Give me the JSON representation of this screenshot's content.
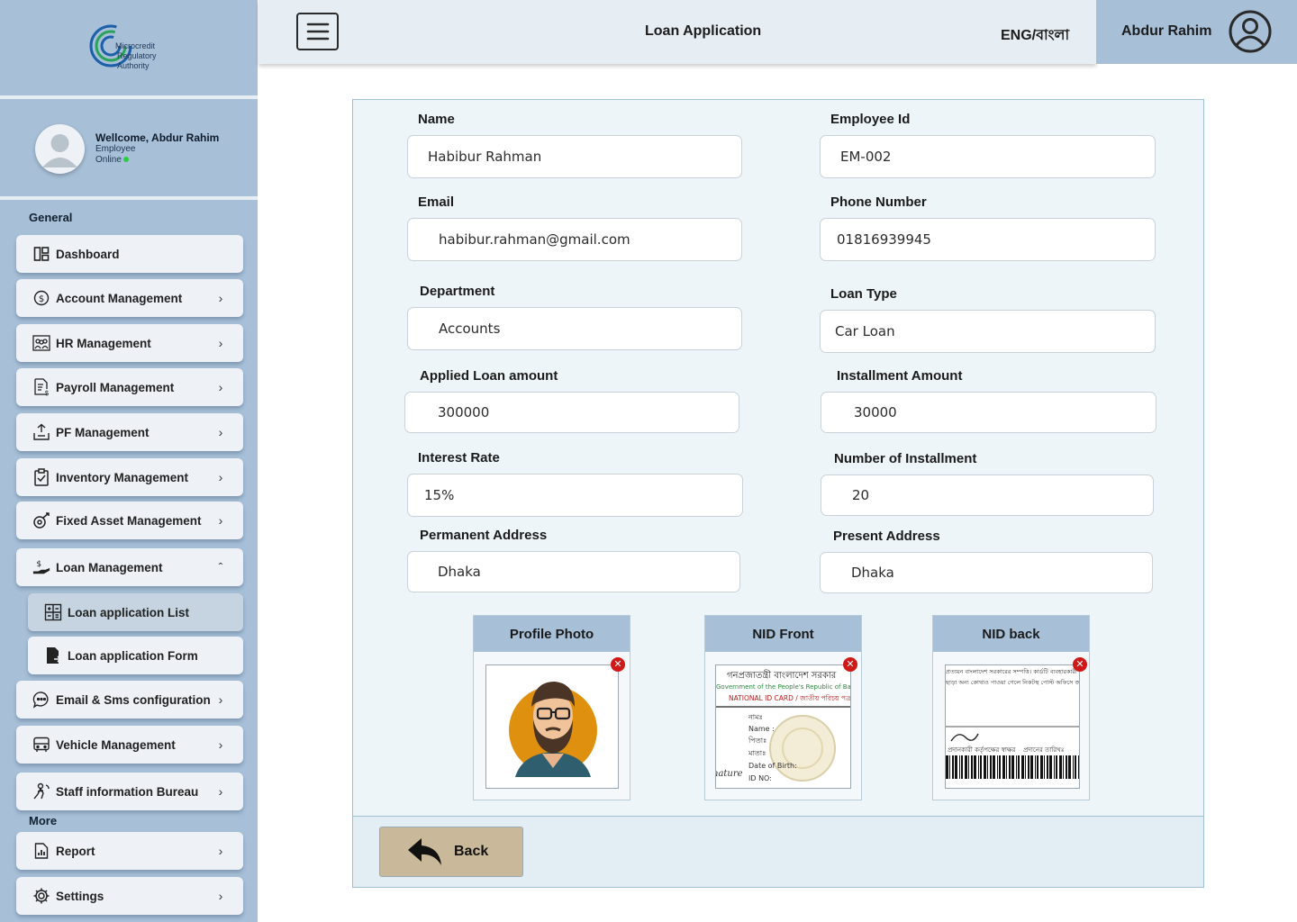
{
  "sidebar": {
    "logo_text": [
      "Microcredit",
      "Regulatory",
      "Authority"
    ],
    "welcome": "Wellcome, Abdur Rahim",
    "role": "Employee",
    "status": "Online",
    "section_general": "General",
    "section_more": "More",
    "items": [
      {
        "label": "Dashboard",
        "icon": "dashboard-icon"
      },
      {
        "label": "Account Management",
        "icon": "dollar-circle-icon"
      },
      {
        "label": "HR Management",
        "icon": "team-icon"
      },
      {
        "label": "Payroll Management",
        "icon": "payroll-icon"
      },
      {
        "label": "PF Management",
        "icon": "pf-icon"
      },
      {
        "label": "Inventory Management",
        "icon": "clipboard-check-icon"
      },
      {
        "label": "Fixed Asset Management",
        "icon": "asset-icon"
      },
      {
        "label": "Loan Management",
        "icon": "hand-money-icon"
      },
      {
        "label": "Loan application List",
        "icon": "calculator-list-icon"
      },
      {
        "label": "Loan application Form",
        "icon": "form-file-icon"
      },
      {
        "label": "Email & Sms configuration",
        "icon": "chat-icon"
      },
      {
        "label": "Vehicle Management",
        "icon": "bus-icon"
      },
      {
        "label": "Staff information Bureau",
        "icon": "staff-icon"
      },
      {
        "label": "Report",
        "icon": "report-icon"
      },
      {
        "label": "Settings",
        "icon": "gear-icon"
      }
    ]
  },
  "header": {
    "title": "Loan Application",
    "language": "ENG/বাংলা",
    "user_name": "Abdur Rahim"
  },
  "form": {
    "name": {
      "label": "Name",
      "value": "Habibur Rahman"
    },
    "employee_id": {
      "label": "Employee Id",
      "value": "EM-002"
    },
    "email": {
      "label": "Email",
      "value": "habibur.rahman@gmail.com"
    },
    "phone": {
      "label": "Phone Number",
      "value": "01816939945"
    },
    "department": {
      "label": "Department",
      "value": "Accounts"
    },
    "loan_type": {
      "label": "Loan Type",
      "value": "Car Loan"
    },
    "applied_amount": {
      "label": "Applied Loan amount",
      "value": "300000"
    },
    "installment_amount": {
      "label": "Installment Amount",
      "value": "30000"
    },
    "interest_rate": {
      "label": "Interest Rate",
      "value": "15%"
    },
    "num_installments": {
      "label": "Number of Installment",
      "value": "20"
    },
    "permanent_address": {
      "label": "Permanent Address",
      "value": "Dhaka"
    },
    "present_address": {
      "label": "Present Address",
      "value": "Dhaka"
    }
  },
  "uploads": {
    "profile_photo": "Profile Photo",
    "nid_front": "NID Front",
    "nid_back": "NID back",
    "nid_front_lines": [
      "গনপ্রজাতন্ত্রী বাংলাদেশ সরকার",
      "Government of the People's Republic of Bangladesh",
      "NATIONAL ID CARD / জাতীয় পরিচয় পত্র",
      "নামঃ",
      "Name :",
      "পিতাঃ",
      "মাতাঃ",
      "Date of Birth:",
      "ID NO:",
      "nature"
    ],
    "nid_back_lines": [
      "প্রত্যয়ন বাংলাদেশ সরকারের সম্পত্তি। কার্ডটি ব্যবহারকারী",
      "ছাড়া অন্য কোথাও পাওয়া গেলে নিকটস্থ পোস্ট অফিসে জমা দেয়ার জন্য অনুরোধ করা হলো",
      "প্রদানকারী কর্তৃপক্ষের স্বাক্ষর",
      "প্রদানের তারিখঃ"
    ]
  },
  "actions": {
    "back": "Back"
  },
  "colors": {
    "sidebar": "#a7c0d8",
    "header": "#e6edf3",
    "back_button": "#c9b99a",
    "remove": "#d01818"
  }
}
